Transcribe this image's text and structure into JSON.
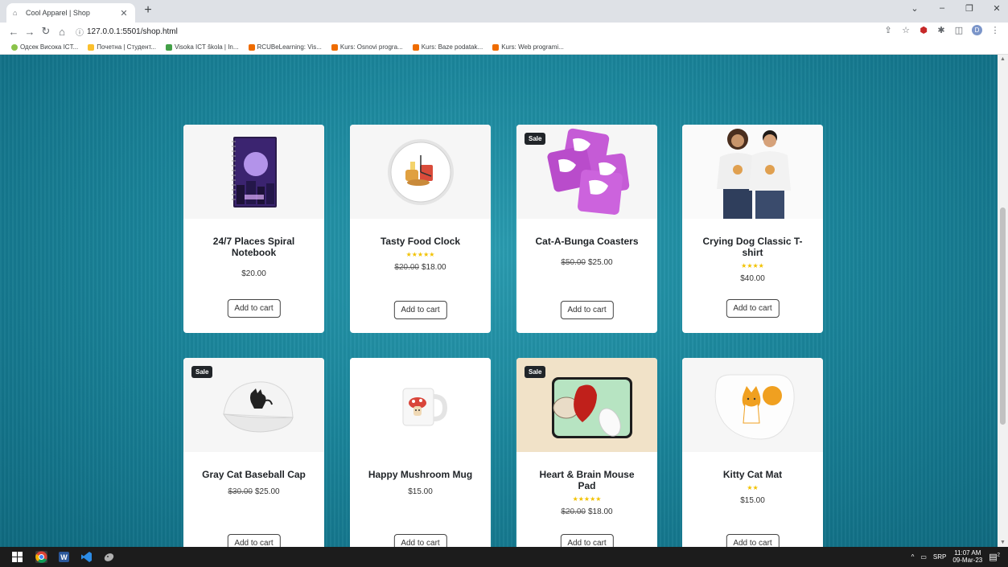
{
  "browser": {
    "tab_title": "Cool Apparel | Shop",
    "url": "127.0.0.1:5501/shop.html",
    "bookmarks": [
      {
        "label": "Одсек Висока ICT...",
        "color": "#8bc34a"
      },
      {
        "label": "Почетна | Студент...",
        "color": "#fbc02d"
      },
      {
        "label": "Visoka ICT škola | In...",
        "color": "#43a047"
      },
      {
        "label": "RCUBeLearning: Vis...",
        "color": "#ef6c00"
      },
      {
        "label": "Kurs: Osnovi progra...",
        "color": "#ef6c00"
      },
      {
        "label": "Kurs: Baze podatak...",
        "color": "#ef6c00"
      },
      {
        "label": "Kurs: Web programi...",
        "color": "#ef6c00"
      }
    ],
    "avatar_letter": "D"
  },
  "products": [
    {
      "title": "24/7 Places Spiral Notebook",
      "stars": "",
      "old_price": "",
      "price": "$20.00",
      "sale": false,
      "button": "Add to cart",
      "image": "notebook"
    },
    {
      "title": "Tasty Food Clock",
      "stars": "★★★★★",
      "old_price": "$20.00",
      "price": "$18.00",
      "sale": false,
      "button": "Add to cart",
      "image": "clock"
    },
    {
      "title": "Cat-A-Bunga Coasters",
      "stars": "",
      "old_price": "$50.00",
      "price": "$25.00",
      "sale": true,
      "sale_label": "Sale",
      "button": "Add to cart",
      "image": "coasters"
    },
    {
      "title": "Crying Dog Classic T-shirt",
      "stars": "★★★★",
      "old_price": "",
      "price": "$40.00",
      "sale": false,
      "button": "Add to cart",
      "image": "tshirt"
    },
    {
      "title": "Gray Cat Baseball Cap",
      "stars": "",
      "old_price": "$30.00",
      "price": "$25.00",
      "sale": true,
      "sale_label": "Sale",
      "button": "Add to cart",
      "image": "cap"
    },
    {
      "title": "Happy Mushroom Mug",
      "stars": "",
      "old_price": "",
      "price": "$15.00",
      "sale": false,
      "button": "Add to cart",
      "image": "mug"
    },
    {
      "title": "Heart & Brain Mouse Pad",
      "stars": "★★★★★",
      "old_price": "$20.00",
      "price": "$18.00",
      "sale": true,
      "sale_label": "Sale",
      "button": "Add to cart",
      "image": "mousepad"
    },
    {
      "title": "Kitty Cat Mat",
      "stars": "★★",
      "old_price": "",
      "price": "$15.00",
      "sale": false,
      "button": "Add to cart",
      "image": "mat"
    }
  ],
  "taskbar": {
    "lang": "SRP",
    "time": "11:07 AM",
    "date": "09-Mar-23",
    "notifications": "2"
  }
}
